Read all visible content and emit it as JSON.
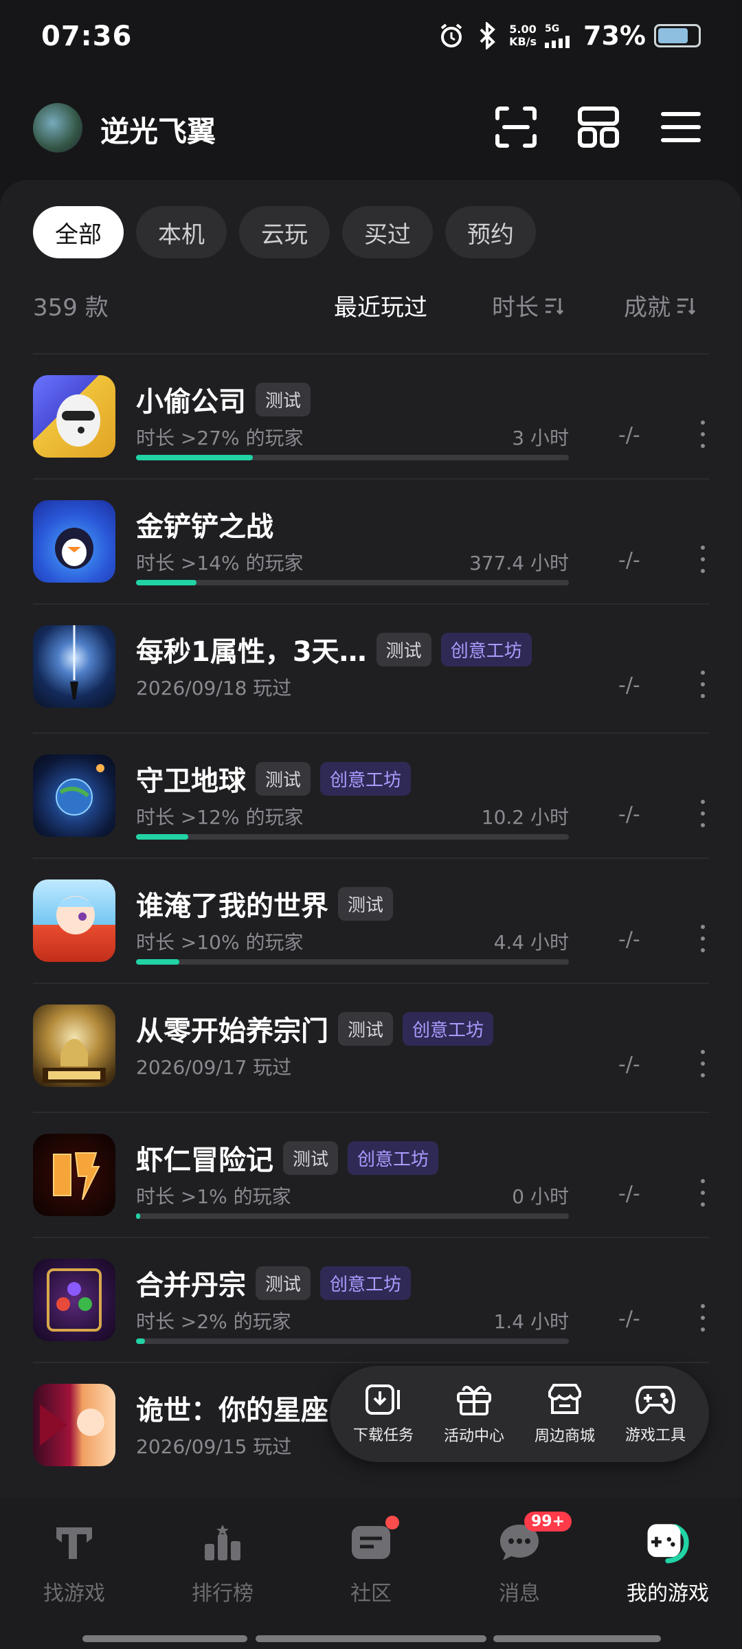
{
  "status": {
    "time": "07:36",
    "speed_top": "5.00",
    "speed_bottom": "KB/s",
    "signal": "5G",
    "battery": "73%"
  },
  "header": {
    "username": "逆光飞翼"
  },
  "tabs": [
    "全部",
    "本机",
    "云玩",
    "买过",
    "预约"
  ],
  "sort": {
    "count": "359 款",
    "recent": "最近玩过",
    "duration": "时长",
    "achievement": "成就"
  },
  "games": [
    {
      "title": "小偷公司",
      "tags": [
        "测试"
      ],
      "sub": "时长 >27% 的玩家",
      "hours": "3 小时",
      "progress": 0.27,
      "ach": "-/-"
    },
    {
      "title": "金铲铲之战",
      "tags": [],
      "sub": "时长 >14% 的玩家",
      "hours": "377.4 小时",
      "progress": 0.14,
      "ach": "-/-"
    },
    {
      "title": "每秒1属性，3天…",
      "tags": [
        "测试",
        "创意工坊"
      ],
      "sub": "2026/09/18 玩过",
      "hours": "",
      "progress": null,
      "ach": "-/-"
    },
    {
      "title": "守卫地球",
      "tags": [
        "测试",
        "创意工坊"
      ],
      "sub": "时长 >12% 的玩家",
      "hours": "10.2 小时",
      "progress": 0.12,
      "ach": "-/-"
    },
    {
      "title": "谁淹了我的世界",
      "tags": [
        "测试"
      ],
      "sub": "时长 >10% 的玩家",
      "hours": "4.4 小时",
      "progress": 0.1,
      "ach": "-/-"
    },
    {
      "title": "从零开始养宗门",
      "tags": [
        "测试",
        "创意工坊"
      ],
      "sub": "2026/09/17 玩过",
      "hours": "",
      "progress": null,
      "ach": "-/-"
    },
    {
      "title": "虾仁冒险记",
      "tags": [
        "测试",
        "创意工坊"
      ],
      "sub": "时长 >1% 的玩家",
      "hours": "0 小时",
      "progress": 0.01,
      "ach": "-/-"
    },
    {
      "title": "合并丹宗",
      "tags": [
        "测试",
        "创意工坊"
      ],
      "sub": "时长 >2% 的玩家",
      "hours": "1.4 小时",
      "progress": 0.02,
      "ach": "-/-"
    },
    {
      "title": "诡世：你的星座",
      "tags": [],
      "sub": "2026/09/15 玩过",
      "hours": "",
      "progress": null,
      "ach": ""
    }
  ],
  "float_menu": [
    "下载任务",
    "活动中心",
    "周边商城",
    "游戏工具"
  ],
  "bottom_nav": [
    "找游戏",
    "排行榜",
    "社区",
    "消息",
    "我的游戏"
  ],
  "message_badge": "99+",
  "colors": {
    "accent": "#21d3a5",
    "creative_tag": "#a99cff",
    "badge": "#ff3b4a"
  }
}
